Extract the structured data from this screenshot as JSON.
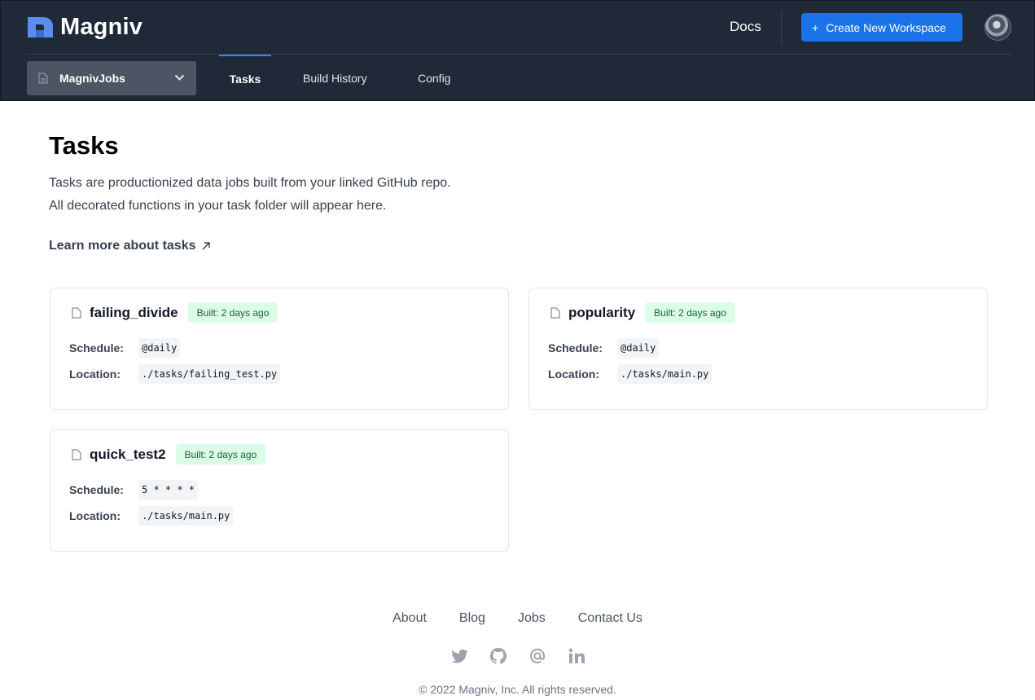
{
  "header": {
    "brand": "Magniv",
    "docs_label": "Docs",
    "create_button_label": "Create New Workspace",
    "create_button_icon": "plus",
    "workspace": "MagnivJobs"
  },
  "tabs": [
    {
      "label": "Tasks",
      "active": true
    },
    {
      "label": "Build History",
      "active": false
    },
    {
      "label": "Config",
      "active": false
    }
  ],
  "main": {
    "title": "Tasks",
    "description": "Tasks are productionized data jobs built from your linked GitHub repo. All decorated functions in your task folder will appear here.",
    "learn_more": "Learn more about tasks"
  },
  "labels": {
    "schedule": "Schedule:",
    "location": "Location:"
  },
  "tasks": [
    {
      "name": "failing_divide",
      "badge": "Built: 2 days ago",
      "schedule": "@daily",
      "location": "./tasks/failing_test.py"
    },
    {
      "name": "popularity",
      "badge": "Built: 2 days ago",
      "schedule": "@daily",
      "location": "./tasks/main.py"
    },
    {
      "name": "quick_test2",
      "badge": "Built: 2 days ago",
      "schedule": "5 * * * *",
      "location": "./tasks/main.py"
    }
  ],
  "footer": {
    "links": [
      "About",
      "Blog",
      "Jobs",
      "Contact Us"
    ],
    "socials": [
      "twitter-icon",
      "github-icon",
      "email-icon",
      "linkedin-icon"
    ],
    "copyright": "© 2022 Magniv, Inc. All rights reserved."
  },
  "colors": {
    "header_bg": "#1f2937",
    "accent": "#1a73e8",
    "badge_bg": "#dcfce7",
    "badge_text": "#166534"
  }
}
